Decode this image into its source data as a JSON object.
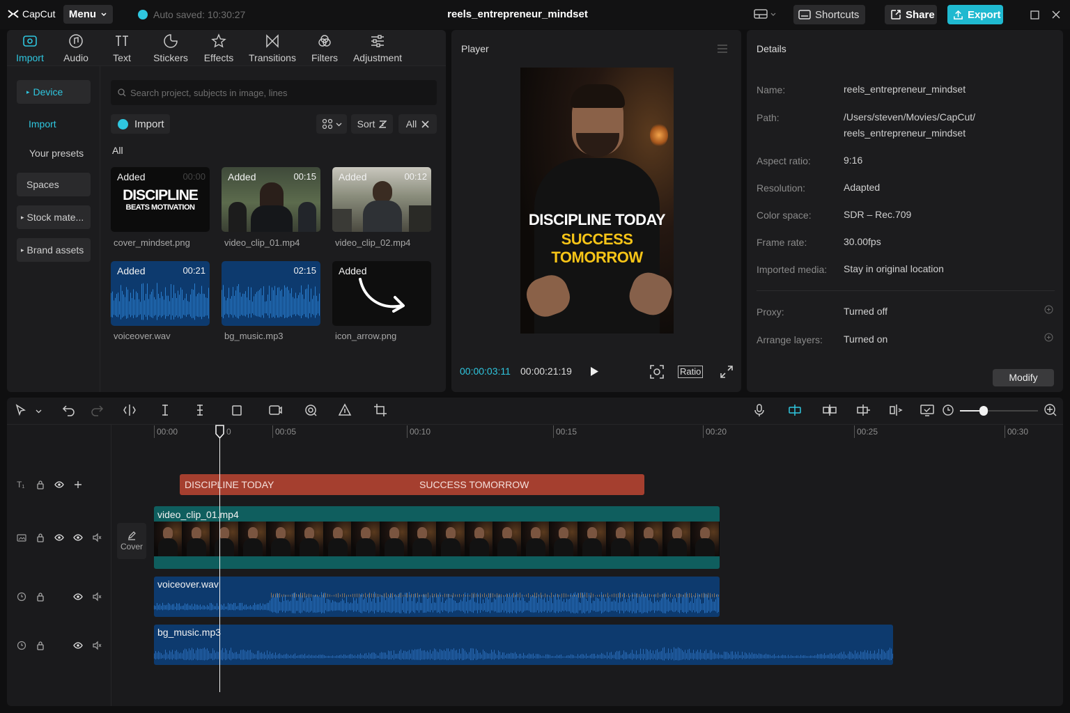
{
  "app": {
    "logo": "CapCut",
    "menu": "Menu",
    "autosave": "Auto saved: 10:30:27",
    "project_title": "reels_entrepreneur_mindset",
    "shortcuts": "Shortcuts",
    "share": "Share",
    "export": "Export"
  },
  "media_tabs": [
    {
      "label": "Import"
    },
    {
      "label": "Audio"
    },
    {
      "label": "Text"
    },
    {
      "label": "Stickers"
    },
    {
      "label": "Effects"
    },
    {
      "label": "Transitions"
    },
    {
      "label": "Filters"
    },
    {
      "label": "Adjustment"
    }
  ],
  "sidebar": {
    "device": "Device",
    "import": "Import",
    "presets": "Your presets",
    "spaces": "Spaces",
    "stock": "Stock mate...",
    "brand": "Brand assets"
  },
  "library": {
    "search_placeholder": "Search project, subjects in image, lines",
    "import_btn": "Import",
    "sort": "Sort",
    "all_filter": "All",
    "section": "All",
    "items": [
      {
        "added": "Added",
        "dur": "00:00",
        "name": "cover_mindset.png",
        "t1": "DISCIPLINE",
        "t2": "BEATS MOTIVATION"
      },
      {
        "added": "Added",
        "dur": "00:15",
        "name": "video_clip_01.mp4"
      },
      {
        "added": "Added",
        "dur": "00:12",
        "name": "video_clip_02.mp4"
      },
      {
        "added": "Added",
        "dur": "00:21",
        "name": "voiceover.wav"
      },
      {
        "added": "",
        "dur": "02:15",
        "name": "bg_music.mp3"
      },
      {
        "added": "Added",
        "dur": "",
        "name": "icon_arrow.png"
      }
    ]
  },
  "player": {
    "title": "Player",
    "line1": "DISCIPLINE TODAY",
    "line2": "SUCCESS TOMORROW",
    "current": "00:00:03:11",
    "total": "00:00:21:19",
    "ratio": "Ratio"
  },
  "details": {
    "title": "Details",
    "modify": "Modify",
    "rows": [
      {
        "label": "Name:",
        "value": "reels_entrepreneur_mindset"
      },
      {
        "label": "Path:",
        "value": "/Users/steven/Movies/CapCut/",
        "value2": "reels_entrepreneur_mindset"
      },
      {
        "label": "Aspect ratio:",
        "value": "9:16"
      },
      {
        "label": "Resolution:",
        "value": "Adapted"
      },
      {
        "label": "Color space:",
        "value": "SDR – Rec.709"
      },
      {
        "label": "Frame rate:",
        "value": "30.00fps"
      },
      {
        "label": "Imported media:",
        "value": "Stay in original location"
      },
      {
        "label": "Proxy:",
        "value": "Turned off"
      },
      {
        "label": "Arrange layers:",
        "value": "Turned on"
      }
    ]
  },
  "timeline": {
    "ticks": [
      "00:00",
      "0",
      "00:05",
      "00:10",
      "00:15",
      "00:20",
      "00:25",
      "00:30"
    ],
    "text_clip1": "DISCIPLINE TODAY",
    "text_clip2": "SUCCESS TOMORROW",
    "video_clip": "video_clip_01.mp4",
    "cover": "Cover",
    "voice_clip": "voiceover.wav",
    "music_clip": "bg_music.mp3",
    "zoom": 0.3,
    "playhead_time": "00:03"
  },
  "colors": {
    "accent": "#2fc7e0",
    "text_track": "#a53f2f",
    "video_track": "#0f5e5e",
    "audio_track": "#0d3a6e",
    "wave": "#1f6fb8"
  }
}
